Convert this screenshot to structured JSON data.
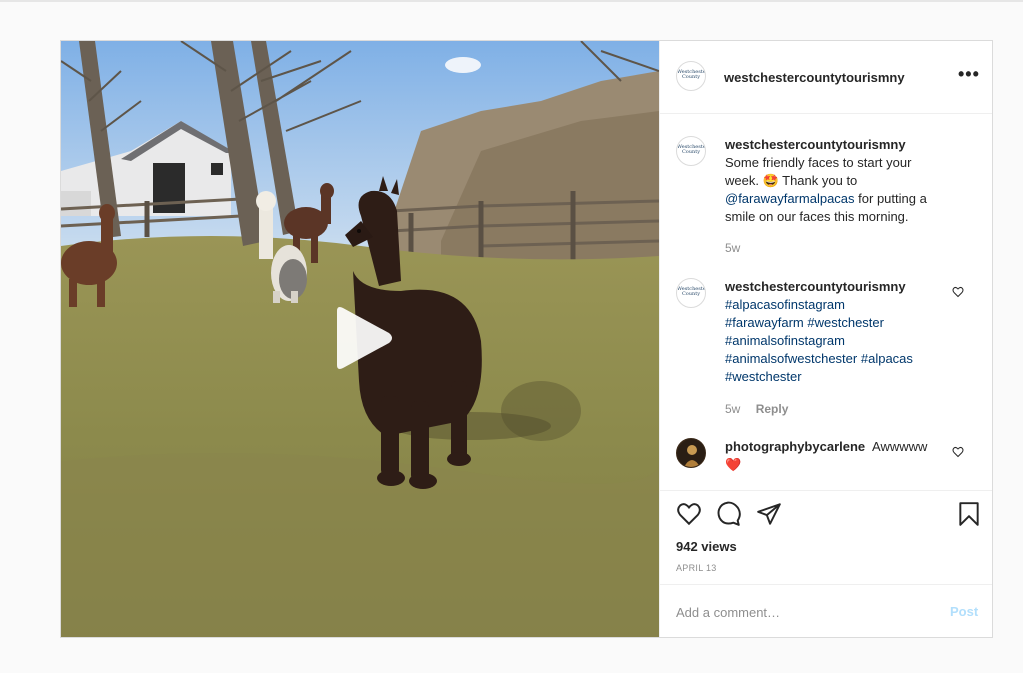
{
  "post": {
    "author": "westchestercountytourismny",
    "avatar_logo_text": "Westchester County",
    "more_icon": "more-horizontal-icon",
    "caption": {
      "username": "westchestercountytourismny",
      "text_before": "Some friendly faces to start your week. 🤩 Thank you to",
      "mention": "@farawayfarmalpacas",
      "text_after": "for putting a smile on our faces this morning.",
      "time": "5w"
    },
    "hashtag_comment": {
      "username": "westchestercountytourismny",
      "tags": [
        "#alpacasofinstagram",
        "#farawayfarm",
        "#westchester",
        "#animalsofinstagram",
        "#animalsofwestchester",
        "#alpacas",
        "#westchester"
      ],
      "time": "5w",
      "reply_label": "Reply"
    },
    "user_comment": {
      "username": "photographybycarlene",
      "text": "Awwwww",
      "emoji": "❤️"
    },
    "actions": {
      "like_icon": "heart-icon",
      "comment_icon": "comment-icon",
      "share_icon": "share-icon",
      "save_icon": "bookmark-icon"
    },
    "views": "942 views",
    "date": "APRIL 13",
    "comment_input": {
      "placeholder": "Add a comment…",
      "post_label": "Post"
    }
  },
  "media": {
    "type": "video",
    "play_icon": "play-icon"
  },
  "colors": {
    "link": "#00376b",
    "post_button_disabled": "#b2dffc",
    "muted": "#8e8e8e",
    "border": "#dbdbdb"
  }
}
